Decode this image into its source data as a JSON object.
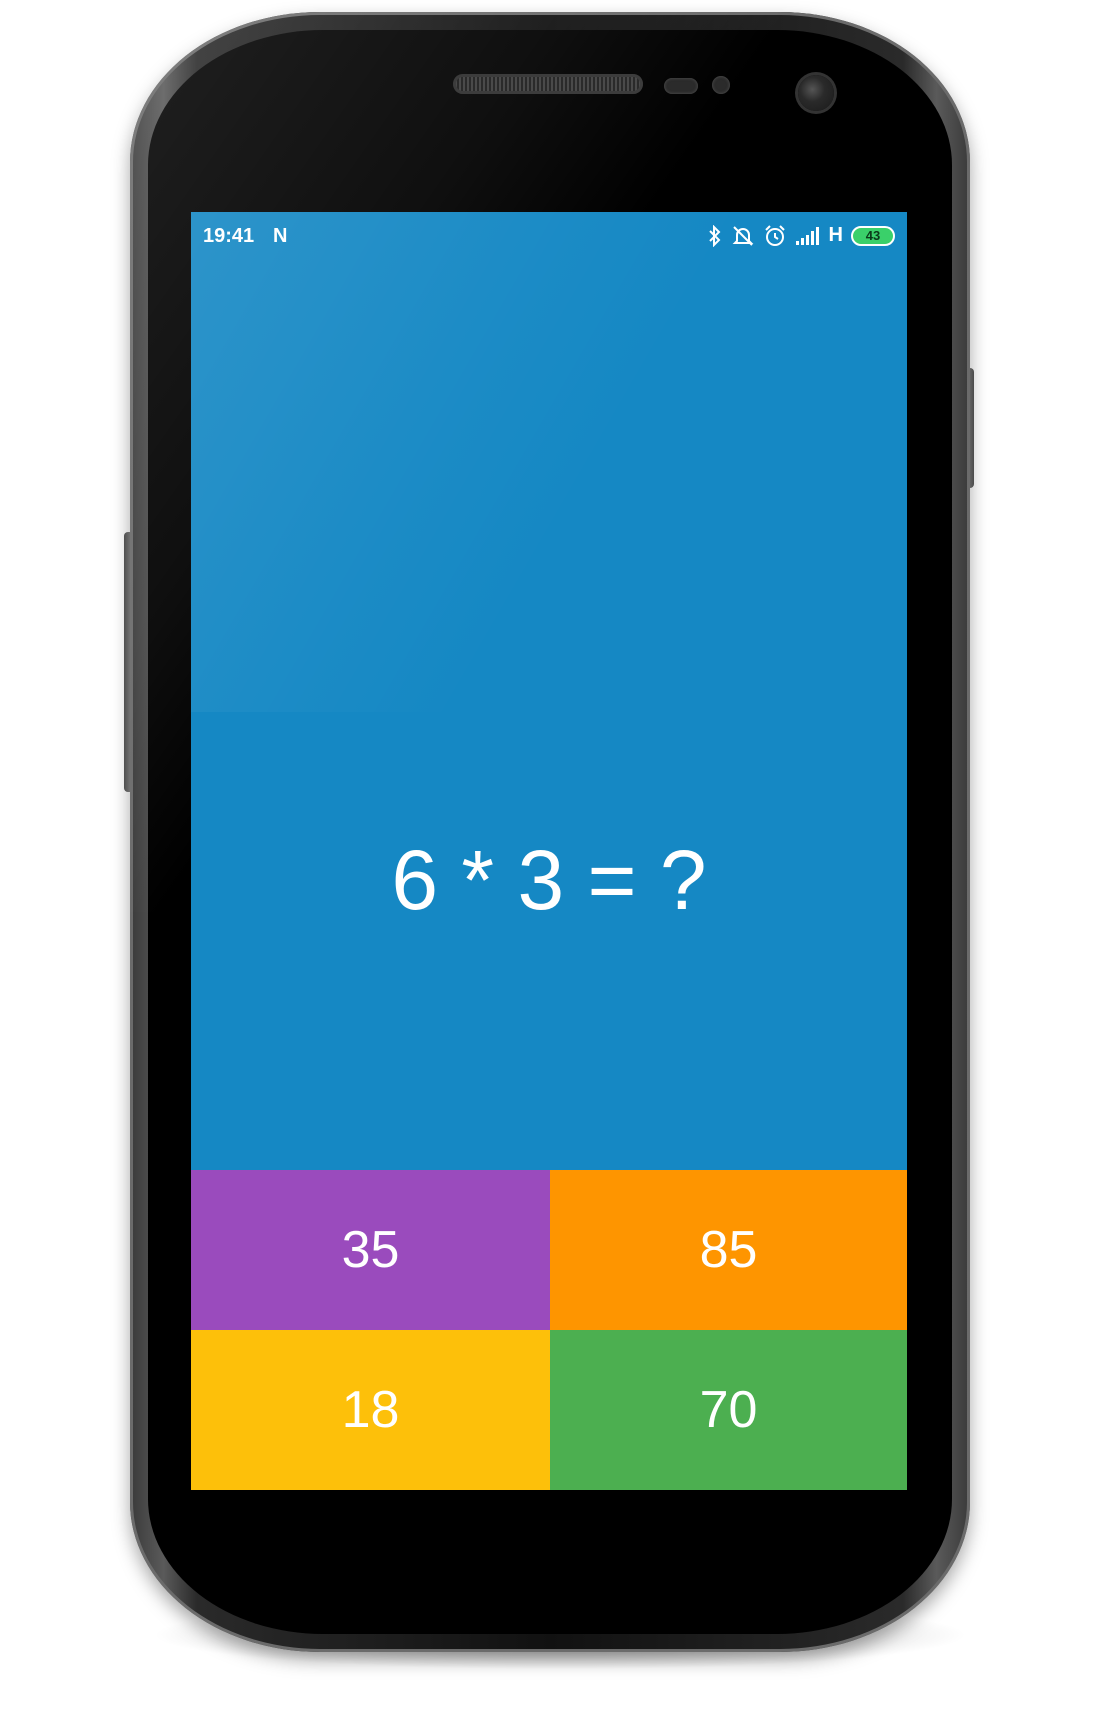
{
  "status_bar": {
    "time": "19:41",
    "notification_icon": "N",
    "network": "H",
    "battery": "43",
    "icons": [
      "bluetooth-icon",
      "alarm-off-icon",
      "alarm-clock-icon",
      "signal-icon"
    ]
  },
  "game": {
    "question": "6 * 3 = ?",
    "answers": [
      {
        "label": "35",
        "color": "#9a4bbd"
      },
      {
        "label": "85",
        "color": "#fe9500"
      },
      {
        "label": "18",
        "color": "#fdc00a"
      },
      {
        "label": "70",
        "color": "#4caf50"
      }
    ],
    "background": "#1588c4"
  }
}
